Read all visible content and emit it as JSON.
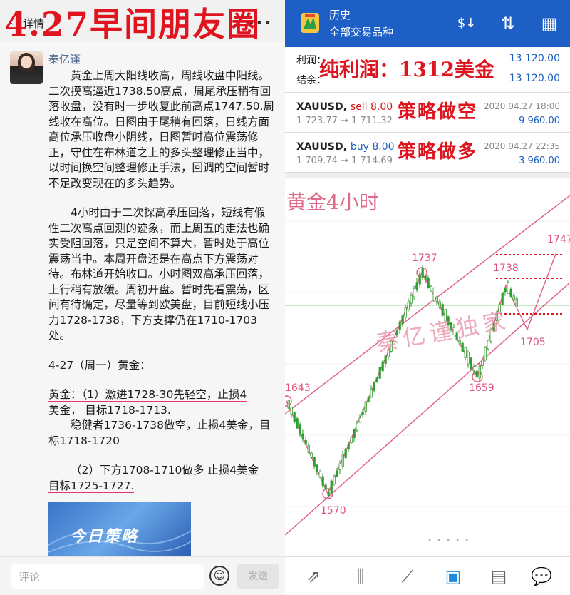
{
  "left": {
    "topbar": {
      "back_icon": "‹",
      "title": "详情",
      "more_icon": "•••"
    },
    "overlay_title": "4.27早间朋友圈",
    "author": "秦亿谨",
    "paragraphs": [
      "黄金上周大阳线收高，周线收盘中阳线。二次摸高逼近1738.50高点，周尾承压稍有回落收盘，没有时一步收复此前高点1747.50.周线收在高位。日图由于尾稍有回落，日线方面高位承压收盘小阴线，日图暂时高位震荡修正，守住在布林道之上的多头整理修正当中，以时间换空间整理修正手法，回调的空间暂时不足改变现在的多头趋势。",
      "4小时由于二次探高承压回落，短线有假性二次高点回测的迹象，而上周五的走法也确实受阻回落，只是空间不算大，暂时处于高位震荡当中。本周开盘还是在高点下方震荡对待。布林道开始收口。小时图双高承压回落，上行稍有放缓。周初开盘。暂时先看震荡，区间有待确定，尽量等到欧美盘，目前短线小压力1728-1738，下方支撑仍在1710-1703处。"
    ],
    "date_line": "4-27（周一）黄金：",
    "plan1_a": "黄金：（1）激进1728-30先轻空，止损4",
    "plan1_b": "美金， 目标1718-1713.",
    "plan1_c": "稳健者1736-1738做空，止损4美金，目标1718-1720",
    "plan2_a": "（2）下方1708-1710做多 止损4美金",
    "plan2_b": "目标1725-1727.",
    "thumb_text": "今日策略",
    "comment_placeholder": "评论",
    "emoji_icon": "☺",
    "send_label": "发送"
  },
  "right": {
    "header": {
      "title": "历史",
      "subtitle": "全部交易品种",
      "icon_sort": "$↓",
      "icon_updown": "⇅",
      "icon_calendar": "▦"
    },
    "summary": {
      "profit_label": "利润：",
      "profit_value": "13 120.00",
      "balance_label": "结余：",
      "balance_value": "13 120.00",
      "overlay": "纯利润：1312美金"
    },
    "trades": [
      {
        "symbol": "XAUUSD,",
        "side": "sell 8.00",
        "side_type": "sell",
        "prices": "1 723.77 → 1 711.32",
        "date": "2020.04.27 18:00",
        "profit": "9 960.00",
        "overlay": "策略做空"
      },
      {
        "symbol": "XAUUSD,",
        "side": "buy 8.00",
        "side_type": "buy",
        "prices": "1 709.74 → 1 714.69",
        "date": "2020.04.27 22:35",
        "profit": "3 960.00",
        "overlay": "策略做多"
      }
    ],
    "chart": {
      "title": "黄金4小时",
      "watermark": "秦亿谨独家",
      "levels": {
        "l1747": "1747",
        "l1738": "1738",
        "l1737": "1737",
        "l1705": "1705",
        "l1659": "1659",
        "l1643": "1643",
        "l1570": "1570"
      }
    },
    "dots": "• • • • •",
    "tabs": [
      {
        "icon": "⇗",
        "name": "quotes-tab-icon"
      },
      {
        "icon": "⫼",
        "name": "chart-bars-tab-icon"
      },
      {
        "icon": "⟋",
        "name": "trade-tab-icon"
      },
      {
        "icon": "▣",
        "name": "history-tab-icon",
        "active": true
      },
      {
        "icon": "▤",
        "name": "news-tab-icon"
      },
      {
        "icon": "💬",
        "name": "chat-tab-icon"
      }
    ]
  }
}
